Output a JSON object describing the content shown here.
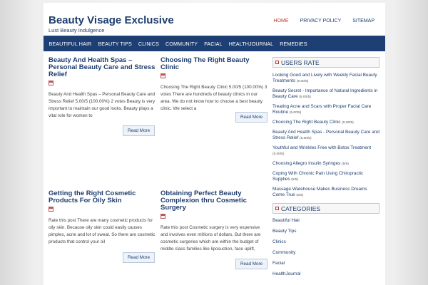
{
  "site": {
    "title": "Beauty Visage Exclusive",
    "tagline": "Lust Beauty Indulgence"
  },
  "top_links": [
    {
      "label": "HOME",
      "active": true
    },
    {
      "label": "PRIVACY POLICY",
      "active": false
    },
    {
      "label": "SITEMAP",
      "active": false
    }
  ],
  "nav": [
    "BEAUTIFUL HAIR",
    "BEAUTY TIPS",
    "CLINICS",
    "COMMUNITY",
    "FACIAL",
    "HEALTHJOURNAL",
    "REMEDIES"
  ],
  "posts": [
    {
      "title": "Beauty And Health Spas – Personal Beauty Care and Stress Relief",
      "excerpt": "Beauty And Health Spas – Personal Beauty Care and Stress Relief 5.00/5 (100.00%) 2 votes Beauty is very important to maintain our good looks. Beauty plays a vital role for women to",
      "readmore": "Read More"
    },
    {
      "title": "Choosing The Right Beauty Clinic",
      "excerpt": "Choosing The Right Beauty Clinic 5.00/5 (100.00%) 3 votes There are hundreds of beauty clinics in our area.  We do not know how to choose a best beauty clinic.  We select a",
      "readmore": "Read More"
    },
    {
      "title": "Getting the Right Cosmetic Products For Oily Skin",
      "excerpt": "Rate this post There are many cosmetic products for oily skin.  Because oily skin could easily causes pimples, acne and lot of sweat.  So there are cosmetic products that control your oil",
      "readmore": "Read More"
    },
    {
      "title": "Obtaining Perfect Beauty Complexion thru Cosmetic Surgery",
      "excerpt": "Rate this post Cosmetic surgery is very expensive and involves even millions of dollars.  But there are cosmetic surgeries which are within the budget of middle class families like liposuction, face uplift,",
      "readmore": "Read More"
    }
  ],
  "sidebar": {
    "users_rate_title": "USERS RATE",
    "users_rate": [
      {
        "label": "Looking Good and Lively with Weekly Facial Beauty Treatments",
        "score": "(5.00/5)"
      },
      {
        "label": "Beauty Secret - Importance of Natural Ingredients in Beauty Care",
        "score": "(5.00/5)"
      },
      {
        "label": "Treating Acne and Scars with Proper Facial Care Routine",
        "score": "(5.00/5)"
      },
      {
        "label": "Choosing The Right Beauty Clinic",
        "score": "(5.00/5)"
      },
      {
        "label": "Beauty And Health Spas - Personal Beauty Care and Stress Relief",
        "score": "(5.00/5)"
      },
      {
        "label": "Youthful and Wrinkles Free with Botox Treatment",
        "score": "(5.00/5)"
      },
      {
        "label": "Choosing Allegro Insulin Syringes",
        "score": "(5/5)"
      },
      {
        "label": "Coping With Chronic Pain Using Chiropractic Supplies",
        "score": "(5/5)"
      },
      {
        "label": "Massage Warehouse Makes Business Dreams Come True",
        "score": "(5/5)"
      }
    ],
    "categories_title": "CATEGORIES",
    "categories": [
      "Beautiful Hair",
      "Beauty Tips",
      "Clinics",
      "Community",
      "Facial",
      "HealthJournal"
    ]
  },
  "colors": {
    "brand_navy": "#1e3f73",
    "active_link": "#c0392b"
  }
}
